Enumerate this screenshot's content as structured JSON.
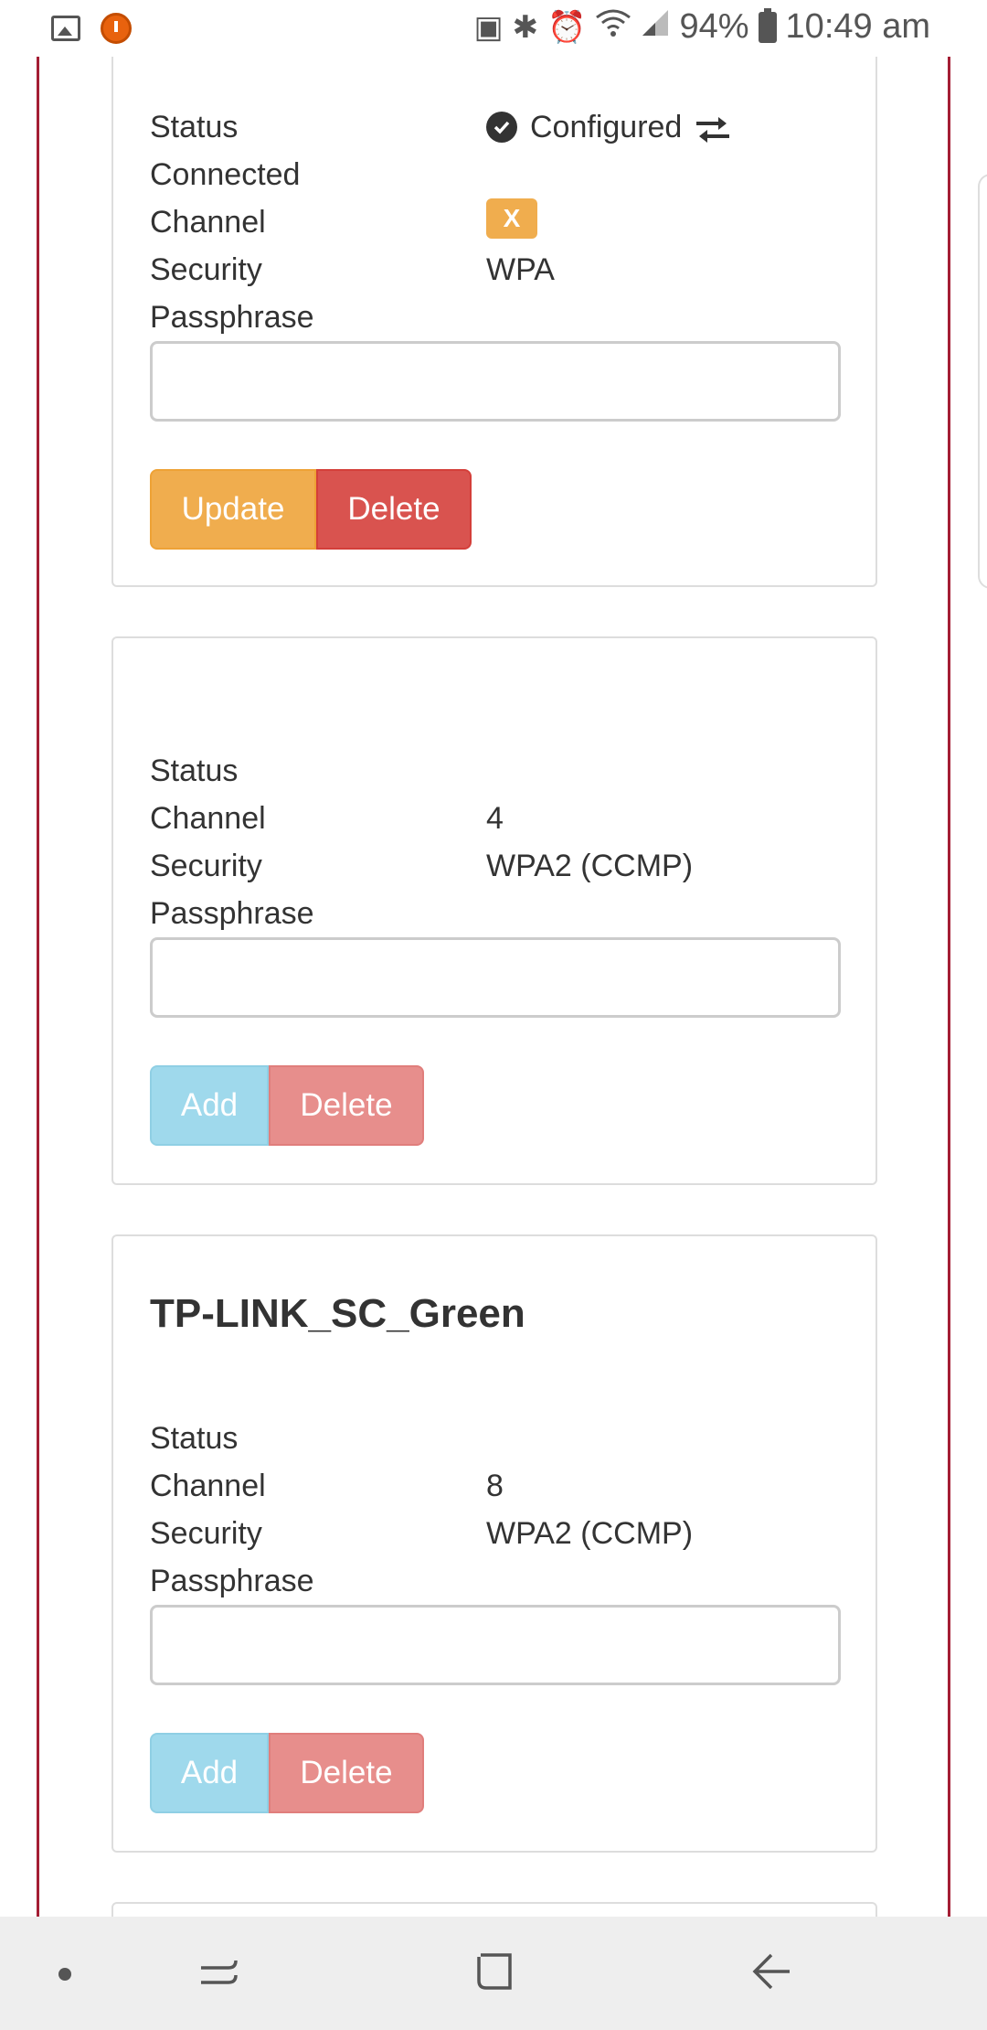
{
  "status_bar": {
    "battery_percent": "94%",
    "time": "10:49 am",
    "left_icons": [
      "gallery-icon",
      "screen-recorder-icon"
    ],
    "right_icons": [
      "battery-saver-icon",
      "bluetooth-icon",
      "alarm-icon",
      "wifi-icon",
      "signal-icon",
      "battery-icon"
    ]
  },
  "networks": [
    {
      "ssid": "",
      "rows": [
        {
          "label": "Status",
          "value": "Configured"
        },
        {
          "label": "Connected",
          "value": ""
        },
        {
          "label": "Channel",
          "value": "X"
        },
        {
          "label": "Security",
          "value": "WPA"
        }
      ],
      "passphrase_label": "Passphrase",
      "passphrase_value": "",
      "primary_button": "Update",
      "delete_button": "Delete"
    },
    {
      "ssid": "",
      "rows": [
        {
          "label": "Status",
          "value": ""
        },
        {
          "label": "Channel",
          "value": "4"
        },
        {
          "label": "Security",
          "value": "WPA2 (CCMP)"
        }
      ],
      "passphrase_label": "Passphrase",
      "passphrase_value": "",
      "primary_button": "Add",
      "delete_button": "Delete"
    },
    {
      "ssid": "TP-LINK_SC_Green",
      "rows": [
        {
          "label": "Status",
          "value": ""
        },
        {
          "label": "Channel",
          "value": "8"
        },
        {
          "label": "Security",
          "value": "WPA2 (CCMP)"
        }
      ],
      "passphrase_label": "Passphrase",
      "passphrase_value": "",
      "primary_button": "Add",
      "delete_button": "Delete"
    }
  ],
  "colors": {
    "frame_border": "#a41e34",
    "update": "#f0ad4e",
    "delete": "#d9534f",
    "add_disabled": "#9fd9ec",
    "delete_disabled": "#e78e8c"
  },
  "nav_bar": {
    "icons": [
      "menu-dot-icon",
      "recent-apps-icon",
      "home-icon",
      "back-icon"
    ]
  }
}
